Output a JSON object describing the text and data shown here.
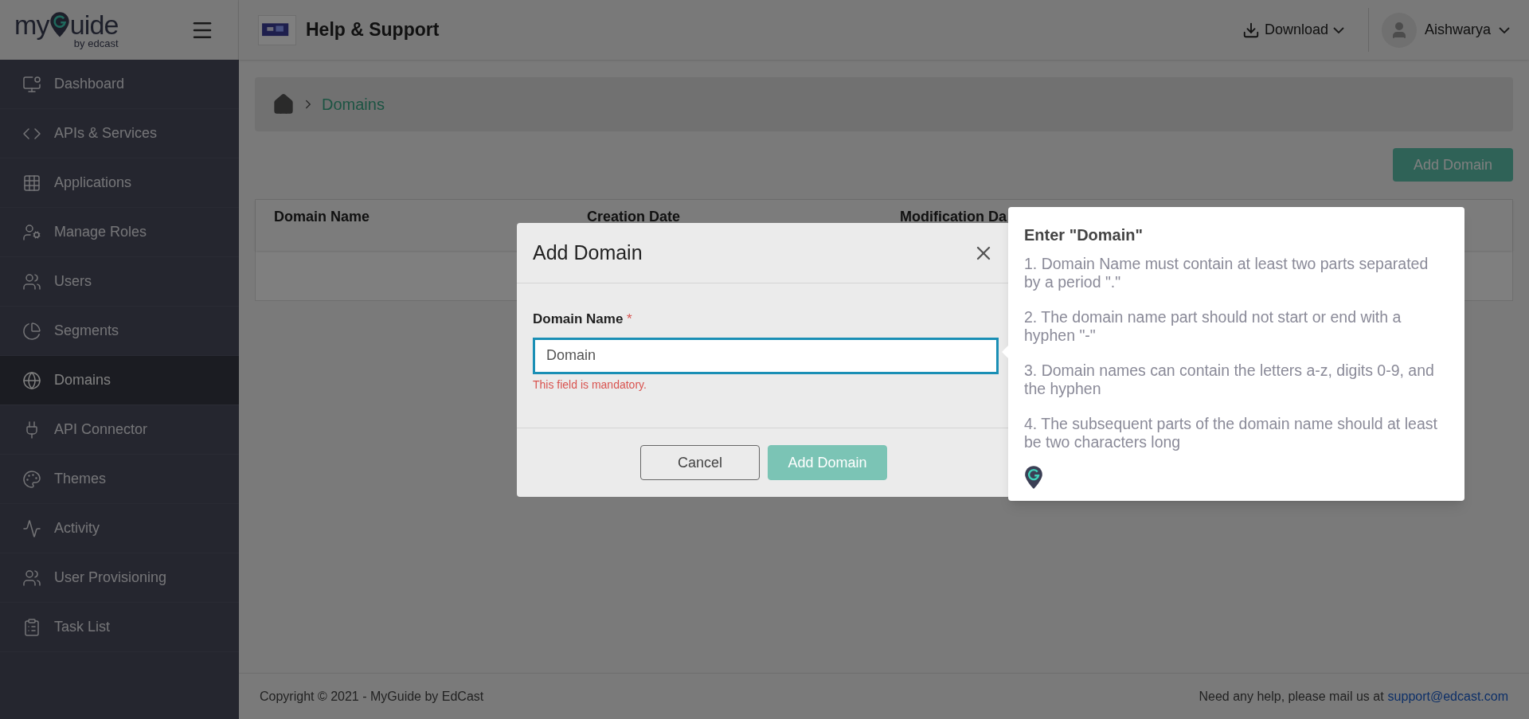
{
  "logo": {
    "lead": "my",
    "tail": "uide",
    "byline": "by",
    "brand": "edcast"
  },
  "header": {
    "title": "Help & Support",
    "download": "Download",
    "user": "Aishwarya"
  },
  "sidebar": {
    "items": [
      {
        "label": "Dashboard",
        "selected": false
      },
      {
        "label": "APIs & Services",
        "selected": false
      },
      {
        "label": "Applications",
        "selected": false
      },
      {
        "label": "Manage Roles",
        "selected": false
      },
      {
        "label": "Users",
        "selected": false
      },
      {
        "label": "Segments",
        "selected": false
      },
      {
        "label": "Domains",
        "selected": true
      },
      {
        "label": "API Connector",
        "selected": false
      },
      {
        "label": "Themes",
        "selected": false
      },
      {
        "label": "Activity",
        "selected": false
      },
      {
        "label": "User Provisioning",
        "selected": false
      },
      {
        "label": "Task List",
        "selected": false
      }
    ]
  },
  "breadcrumb": {
    "current": "Domains"
  },
  "add_domain_button": "Add Domain",
  "table": {
    "columns": [
      "Domain Name",
      "Creation Date",
      "Modification Da"
    ]
  },
  "dialog": {
    "title": "Add Domain",
    "field": {
      "label": "Domain Name",
      "required_mark": "*",
      "placeholder": "Domain",
      "error": "This field is mandatory."
    },
    "buttons": [
      {
        "label": "Cancel",
        "kind": "secondary",
        "disabled": false
      },
      {
        "label": "Add Domain",
        "kind": "primary",
        "disabled": true
      }
    ]
  },
  "guide_tooltip": {
    "title": "Enter \"Domain\"",
    "rules": [
      "1. Domain Name must contain at least two parts separated by a period \".\"",
      "2. The domain name part should not start or end with a hyphen \"-\"",
      "3. Domain names can contain the letters a-z, digits 0-9, and the hyphen",
      "4. The subsequent parts of the domain name should at least be two characters long"
    ]
  },
  "footer": {
    "copyright": "Copyright © 2021 - MyGuide by EdCast",
    "help": "Need any help, please mail us at",
    "email": "support@edcast.com"
  }
}
